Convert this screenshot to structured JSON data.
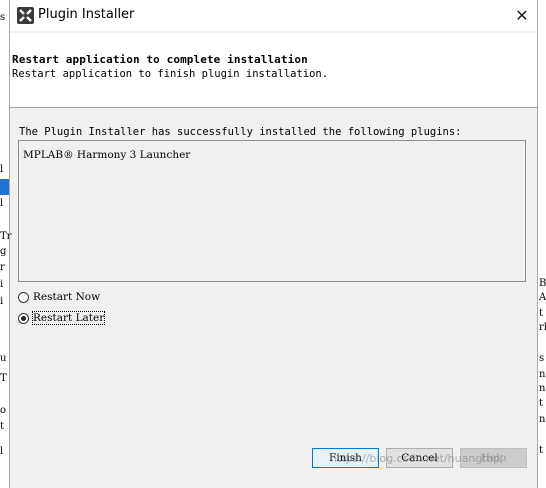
{
  "window": {
    "title": "Plugin Installer",
    "close_symbol": "✕",
    "app_icon": "netbeans-icon"
  },
  "header": {
    "title": "Restart application to complete installation",
    "subtitle": "Restart application to finish plugin installation."
  },
  "body": {
    "message": "The Plugin Installer has successfully installed the following plugins:",
    "plugins": [
      "MPLAB® Harmony 3 Launcher"
    ]
  },
  "options": {
    "restart_now": "Restart Now",
    "restart_later": "Restart Later",
    "selected": "restart_later"
  },
  "buttons": {
    "finish": "Finish",
    "cancel": "Cancel",
    "help": "Help"
  },
  "watermark": "https://blog.csdn.net/huangtop",
  "background_fragments": {
    "left": [
      "s",
      "l",
      "l",
      "Tr",
      "g",
      "r",
      "i",
      "i",
      "u",
      "T",
      "o",
      "t",
      "l"
    ],
    "right": [
      "B",
      "A",
      "t",
      "rb",
      "s",
      "n",
      "n",
      "t",
      "n",
      "t"
    ]
  },
  "colors": {
    "accent": "#0078d7",
    "selection": "#1e73d4"
  }
}
